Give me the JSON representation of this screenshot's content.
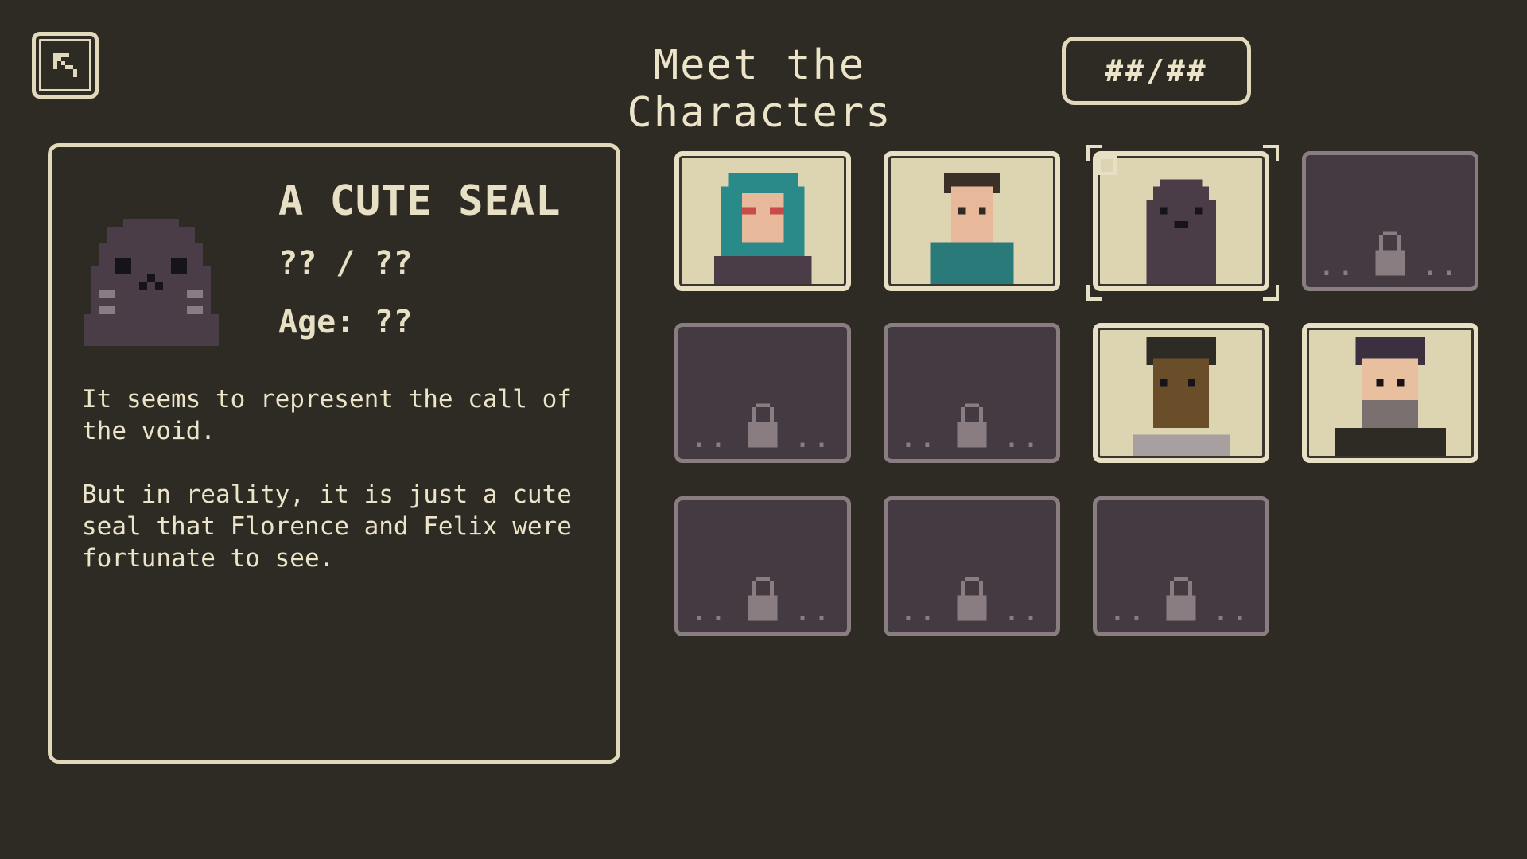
{
  "header": {
    "back_icon": "back-arrow-icon",
    "title": "Meet the Characters",
    "counter": "##/##"
  },
  "detail": {
    "name": "A CUTE SEAL",
    "role": "?? / ??",
    "age": "Age: ??",
    "description_1": "It seems to represent the call of the void.",
    "description_2": "But in reality, it is just a cute seal that Florence and Felix were fortunate to see."
  },
  "grid": {
    "slots": [
      {
        "state": "unlocked",
        "portrait": "woman-teal-hair-glasses"
      },
      {
        "state": "unlocked",
        "portrait": "boy-teal-hoodie"
      },
      {
        "state": "unlocked",
        "portrait": "seal",
        "selected": true
      },
      {
        "state": "locked",
        "portrait": "lock-icon"
      },
      {
        "state": "locked",
        "portrait": "lock-icon"
      },
      {
        "state": "locked",
        "portrait": "lock-icon"
      },
      {
        "state": "unlocked",
        "portrait": "dark-skinned-person"
      },
      {
        "state": "unlocked",
        "portrait": "man-beard"
      },
      {
        "state": "locked",
        "portrait": "lock-icon"
      },
      {
        "state": "locked",
        "portrait": "lock-icon"
      },
      {
        "state": "locked",
        "portrait": "lock-icon"
      }
    ]
  },
  "colors": {
    "background": "#2e2b25",
    "frame": "#e2d9bb",
    "locked_fill": "#433a42",
    "locked_border": "#8a7d82",
    "seal": "#4a3d48"
  }
}
